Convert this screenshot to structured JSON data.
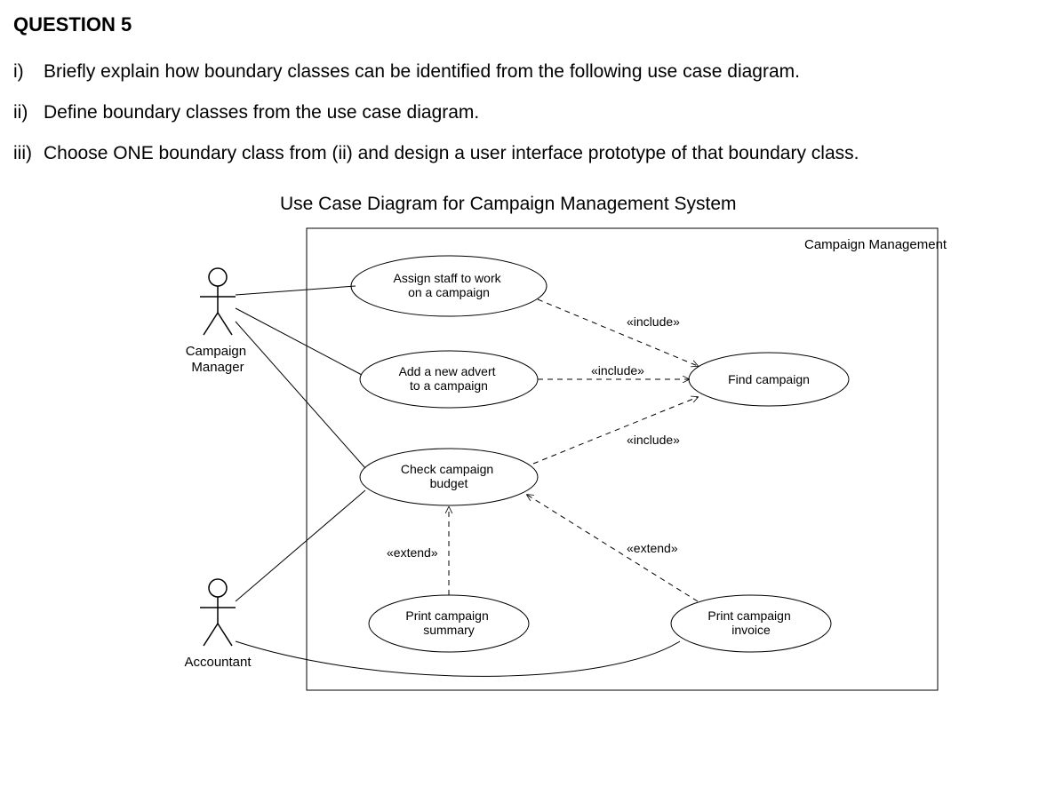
{
  "question": {
    "title": "QUESTION 5",
    "items": [
      {
        "num": "i)",
        "text": "Briefly explain how boundary classes can be identified from the following use case diagram."
      },
      {
        "num": "ii)",
        "text": "Define boundary classes from the use case diagram."
      },
      {
        "num": "iii)",
        "text": "Choose ONE boundary class from (ii) and design a user interface prototype of that boundary class."
      }
    ]
  },
  "diagram": {
    "title": "Use Case Diagram for Campaign Management System",
    "system_label": "Campaign Management",
    "actors": [
      {
        "name": "Campaign Manager"
      },
      {
        "name": "Accountant"
      }
    ],
    "usecases": [
      {
        "id": "assign",
        "label_l1": "Assign staff to work",
        "label_l2": "on a campaign"
      },
      {
        "id": "add",
        "label_l1": "Add a new advert",
        "label_l2": "to a campaign"
      },
      {
        "id": "check",
        "label_l1": "Check campaign",
        "label_l2": "budget"
      },
      {
        "id": "find",
        "label_l1": "Find campaign",
        "label_l2": ""
      },
      {
        "id": "psum",
        "label_l1": "Print campaign",
        "label_l2": "summary"
      },
      {
        "id": "pinv",
        "label_l1": "Print campaign",
        "label_l2": "invoice"
      }
    ],
    "rel_labels": {
      "inc1": "«include»",
      "inc2": "«include»",
      "inc3": "«include»",
      "ext1": "«extend»",
      "ext2": "«extend»"
    }
  },
  "chart_data": {
    "type": "diagram",
    "diagram_type": "uml-use-case",
    "system": "Campaign Management",
    "actors": [
      "Campaign Manager",
      "Accountant"
    ],
    "usecases": [
      "Assign staff to work on a campaign",
      "Add a new advert to a campaign",
      "Check campaign budget",
      "Find campaign",
      "Print campaign summary",
      "Print campaign invoice"
    ],
    "associations": [
      {
        "actor": "Campaign Manager",
        "usecase": "Assign staff to work on a campaign"
      },
      {
        "actor": "Campaign Manager",
        "usecase": "Add a new advert to a campaign"
      },
      {
        "actor": "Campaign Manager",
        "usecase": "Check campaign budget"
      },
      {
        "actor": "Accountant",
        "usecase": "Check campaign budget"
      },
      {
        "actor": "Accountant",
        "usecase": "Print campaign invoice"
      }
    ],
    "includes": [
      {
        "base": "Assign staff to work on a campaign",
        "included": "Find campaign"
      },
      {
        "base": "Add a new advert to a campaign",
        "included": "Find campaign"
      },
      {
        "base": "Check campaign budget",
        "included": "Find campaign"
      }
    ],
    "extends": [
      {
        "extension": "Print campaign summary",
        "base": "Check campaign budget"
      },
      {
        "extension": "Print campaign invoice",
        "base": "Check campaign budget"
      }
    ]
  }
}
